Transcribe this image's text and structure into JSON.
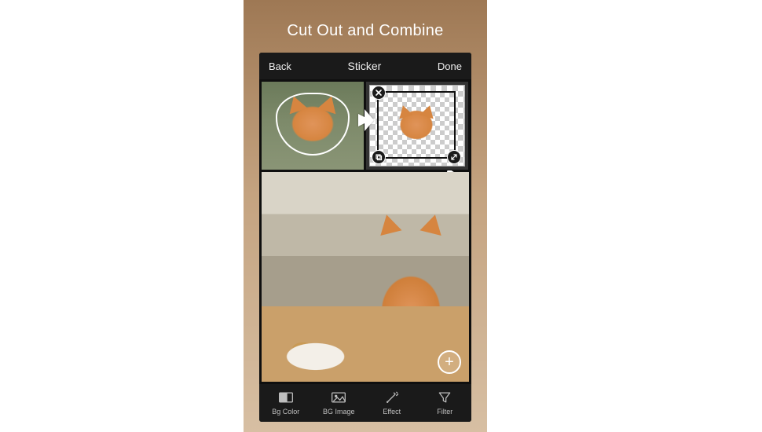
{
  "promo": {
    "title": "Cut Out and Combine"
  },
  "topbar": {
    "back": "Back",
    "title": "Sticker",
    "done": "Done"
  },
  "crop": {
    "close_icon": "close-icon",
    "duplicate_icon": "copy-icon",
    "resize_icon": "resize-icon"
  },
  "add": {
    "label": "+"
  },
  "bottombar": {
    "items": [
      {
        "label": "Bg Color",
        "icon": "bg-color-icon"
      },
      {
        "label": "BG Image",
        "icon": "bg-image-icon"
      },
      {
        "label": "Effect",
        "icon": "effect-icon"
      },
      {
        "label": "Filter",
        "icon": "filter-icon"
      }
    ]
  }
}
